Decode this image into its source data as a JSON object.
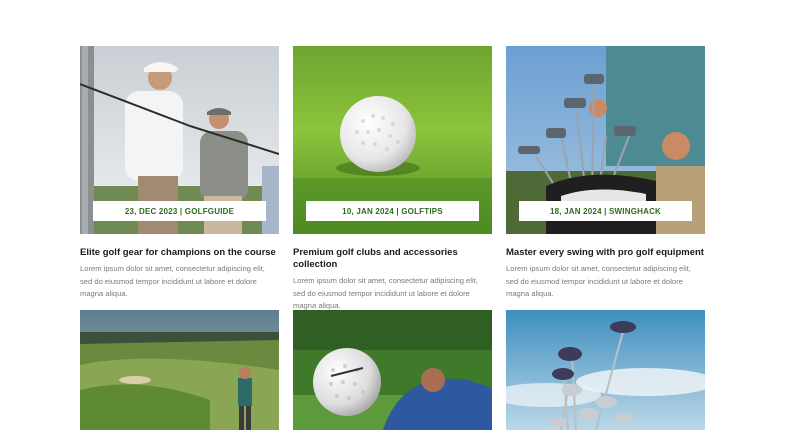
{
  "posts": [
    {
      "date_label": "23, DEC 2023 | GOLFGUIDE",
      "title": "Elite golf gear for champions on the course",
      "excerpt": "Lorem ipsum dolor sit amet, consectetur adipiscing elit, sed do eiusmod tempor incididunt ut labore et dolore magna aliqua."
    },
    {
      "date_label": "10, JAN 2024 | GOLFTIPS",
      "title": "Premium golf clubs and accessories collection",
      "excerpt": "Lorem ipsum dolor sit amet, consectetur adipiscing elit, sed do eiusmod tempor incididunt ut labore et dolore magna aliqua."
    },
    {
      "date_label": "18, JAN 2024 | SWINGHACK",
      "title": "Master every swing with pro golf equipment",
      "excerpt": "Lorem ipsum dolor sit amet, consectetur adipiscing elit, sed do eiusmod tempor incididunt ut labore et dolore magna aliqua."
    }
  ],
  "colors": {
    "badge_text": "#2f6a1f",
    "title_text": "#1b1b1b",
    "excerpt_text": "#7a7a7a"
  }
}
